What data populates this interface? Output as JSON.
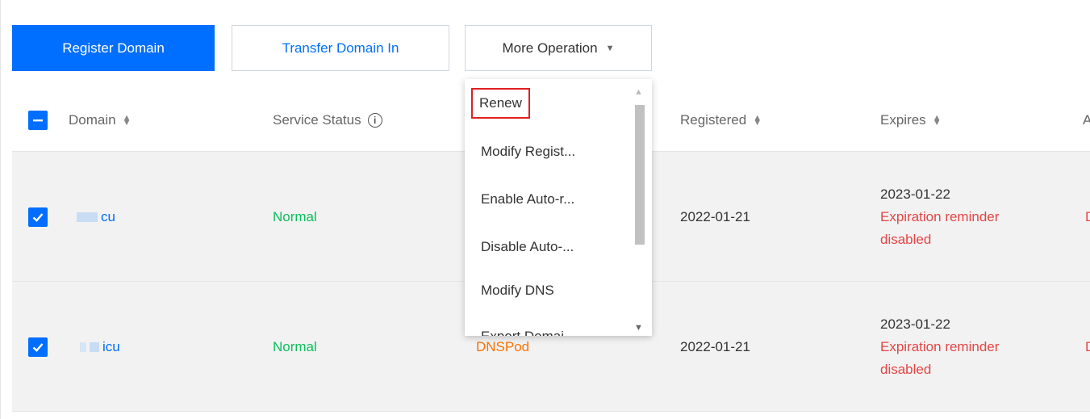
{
  "toolbar": {
    "register_label": "Register Domain",
    "transfer_label": "Transfer Domain In",
    "more_label": "More Operation"
  },
  "table": {
    "headers": {
      "domain": "Domain",
      "service_status": "Service Status",
      "registered": "Registered",
      "expires": "Expires",
      "next": "A"
    },
    "rows": [
      {
        "domain": "cu",
        "status": "Normal",
        "dns": "",
        "registered": "2022-01-21",
        "expires_date": "2023-01-22",
        "expires_note_1": "Expiration reminder",
        "expires_note_2": "disabled",
        "next": "D"
      },
      {
        "domain": "icu",
        "status": "Normal",
        "dns": "DNSPod",
        "registered": "2022-01-21",
        "expires_date": "2023-01-22",
        "expires_note_1": "Expiration reminder",
        "expires_note_2": "disabled",
        "next": "D"
      }
    ]
  },
  "dropdown": {
    "items": [
      "Renew",
      "Modify Regist...",
      "Enable Auto-r...",
      "Disable Auto-...",
      "Modify DNS",
      "Export Domai..."
    ]
  },
  "colors": {
    "primary": "#006eff",
    "status_normal": "#0abf5b",
    "dns": "#ff7200",
    "warning": "#e54545",
    "highlight_border": "#e02020"
  }
}
